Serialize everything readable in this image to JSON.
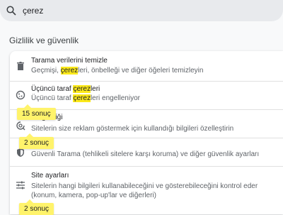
{
  "search": {
    "query": "çerez",
    "icon": "search-icon"
  },
  "section_title": "Gizlilik ve güvenlik",
  "rows": [
    {
      "icon": "trash-icon",
      "title": "Tarama verilerini temizle",
      "desc_pre": "Geçmişi, ",
      "desc_hl": "çerez",
      "desc_post": "leri, önbelleği ve diğer öğeleri temizleyin"
    },
    {
      "icon": "cookie-icon",
      "title_pre": "Üçüncü taraf ",
      "title_hl": "çerez",
      "title_post": "leri",
      "desc_pre": "Üçüncü taraf ",
      "desc_hl": "çerez",
      "desc_post": "leri engelleniyor"
    },
    {
      "icon": "ad-privacy-icon",
      "title": "gizliliği",
      "desc": "Sitelerin size reklam göstermek için kullandığı bilgileri özelleştirin"
    },
    {
      "icon": "shield-icon",
      "title": "",
      "desc": "Güvenli Tarama (tehlikeli sitelere karşı koruma) ve diğer güvenlik ayarları"
    },
    {
      "icon": "tune-icon",
      "title": "Site ayarları",
      "desc": "Sitelerin hangi bilgileri kullanabileceğini ve gösterebileceğini kontrol eder (konum, kamera, pop-up'lar ve diğerleri)"
    }
  ],
  "badges": [
    "15 sonuç",
    "2 sonuç",
    "2 sonuç"
  ]
}
